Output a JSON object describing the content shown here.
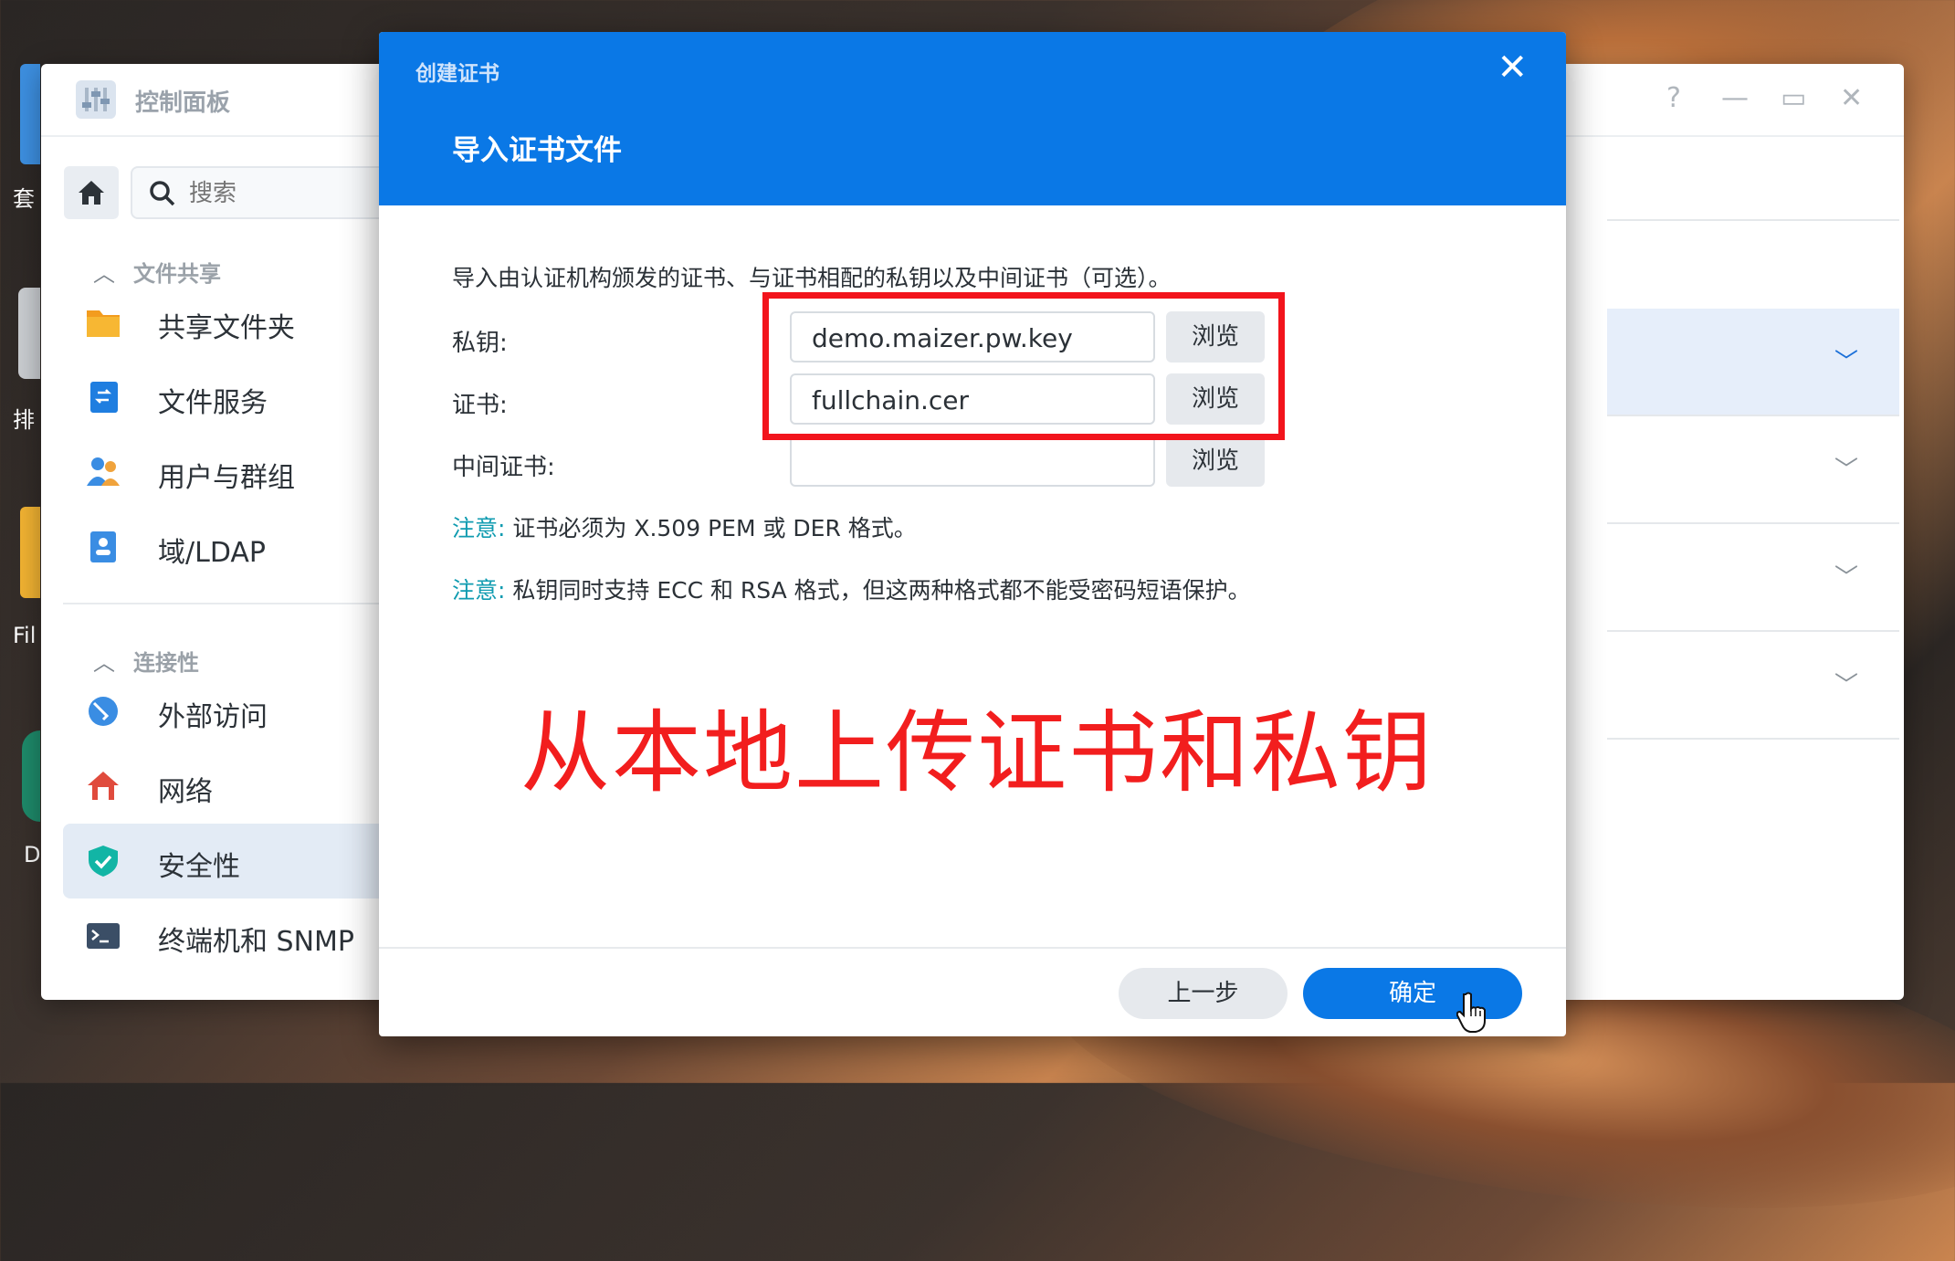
{
  "desktop": {
    "labels": [
      "套",
      "排",
      "Fil",
      "D"
    ]
  },
  "control_panel": {
    "title": "控制面板",
    "window_controls": [
      "?",
      "—",
      "▭",
      "✕"
    ],
    "search": {
      "placeholder": "搜索"
    },
    "sections": [
      {
        "title": "文件共享",
        "items": [
          "共享文件夹",
          "文件服务",
          "用户与群组",
          "域/LDAP"
        ]
      },
      {
        "title": "连接性",
        "items": [
          "外部访问",
          "网络",
          "安全性",
          "终端机和 SNMP"
        ]
      }
    ],
    "active_item": "安全性",
    "icons": {
      "shared-folder": "folder-icon",
      "file-services": "file-service-icon",
      "users-groups": "users-icon",
      "domain-ldap": "ldap-icon",
      "external-access": "globe-icon",
      "network": "network-home-icon",
      "security": "shield-check-icon",
      "terminal": "terminal-icon"
    }
  },
  "dialog": {
    "title": "创建证书",
    "close": "✕",
    "subtitle": "导入证书文件",
    "description": "导入由认证机构颁发的证书、与证书相配的私钥以及中间证书（可选）。",
    "fields": [
      {
        "label": "私钥:",
        "value": "demo.maizer.pw.key",
        "button": "浏览"
      },
      {
        "label": "证书:",
        "value": "fullchain.cer",
        "button": "浏览"
      },
      {
        "label": "中间证书:",
        "value": "",
        "button": "浏览"
      }
    ],
    "notes": [
      {
        "prefix": "注意:",
        "text": " 证书必须为 X.509 PEM 或 DER 格式。"
      },
      {
        "prefix": "注意:",
        "text": " 私钥同时支持 ECC 和 RSA 格式，但这两种格式都不能受密码短语保护。"
      }
    ],
    "annotation": "从本地上传证书和私钥",
    "buttons": {
      "prev": "上一步",
      "ok": "确定"
    }
  },
  "colors": {
    "accent": "#0a78e6",
    "annotation_red": "#f21e1e",
    "note_teal": "#0f9bb0"
  }
}
